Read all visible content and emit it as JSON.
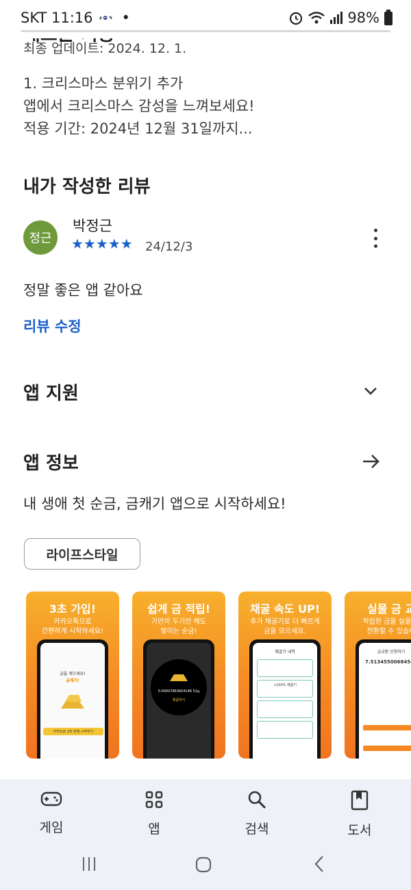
{
  "status": {
    "carrier_time": "SKT 11:16",
    "dot": "•",
    "battery": "98%"
  },
  "whats_new": {
    "title": "새로운 기능",
    "updated": "최종 업데이트: 2024. 12. 1.",
    "notes": [
      "1. 크리스마스 분위기 추가",
      "앱에서 크리스마스 감성을 느껴보세요!",
      "적용 기간: 2024년 12월 31일까지..."
    ]
  },
  "my_review": {
    "section_title": "내가 작성한 리뷰",
    "avatar_text": "정근",
    "reviewer": "박정근",
    "rating": 5,
    "stars": "★★★★★",
    "date": "24/12/3",
    "text": "정말 좋은 앱 같아요",
    "edit_label": "리뷰 수정"
  },
  "app_support": {
    "title": "앱 지원"
  },
  "app_info": {
    "title": "앱 정보",
    "description": "내 생애 첫 순금, 금캐기 앱으로 시작하세요!",
    "category_chip": "라이프스타일"
  },
  "screenshots": [
    {
      "title": "3초 가입!",
      "subtitle": "카카오톡으로\n간편하게 시작하세요!",
      "screen_text": "금을 캐으세요!",
      "screen_accent": "금캐기!",
      "button_text": "카카오로 3초 만에 시작하기"
    },
    {
      "title": "쉽게 금 적립!",
      "subtitle": "가만히 두기만 해도\n쌓이는 순금!",
      "screen_text": "0.00007863604146 51g",
      "screen_accent": "채굴하기"
    },
    {
      "title": "채굴 속도 UP!",
      "subtitle": "추가 채굴기로 더 빠르게\n금을 모으세요.",
      "screen_text": "채굴기 내역",
      "screen_accent": "+100% 채굴기"
    },
    {
      "title": "실물 금 교",
      "subtitle": "적립한 금을 실물 금\n전환할 수 있습니",
      "screen_text": "금교환 신청하기",
      "screen_accent": "7.51345500684546"
    }
  ],
  "bottom_nav": [
    {
      "label": "게임",
      "icon": "gamepad-icon"
    },
    {
      "label": "앱",
      "icon": "apps-grid-icon"
    },
    {
      "label": "검색",
      "icon": "search-icon"
    },
    {
      "label": "도서",
      "icon": "book-icon"
    }
  ],
  "colors": {
    "accent_blue": "#1a5fc9",
    "avatar_green": "#6f9a3c",
    "nav_bg": "#eef1f8",
    "shot_orange": "#f58a24"
  }
}
